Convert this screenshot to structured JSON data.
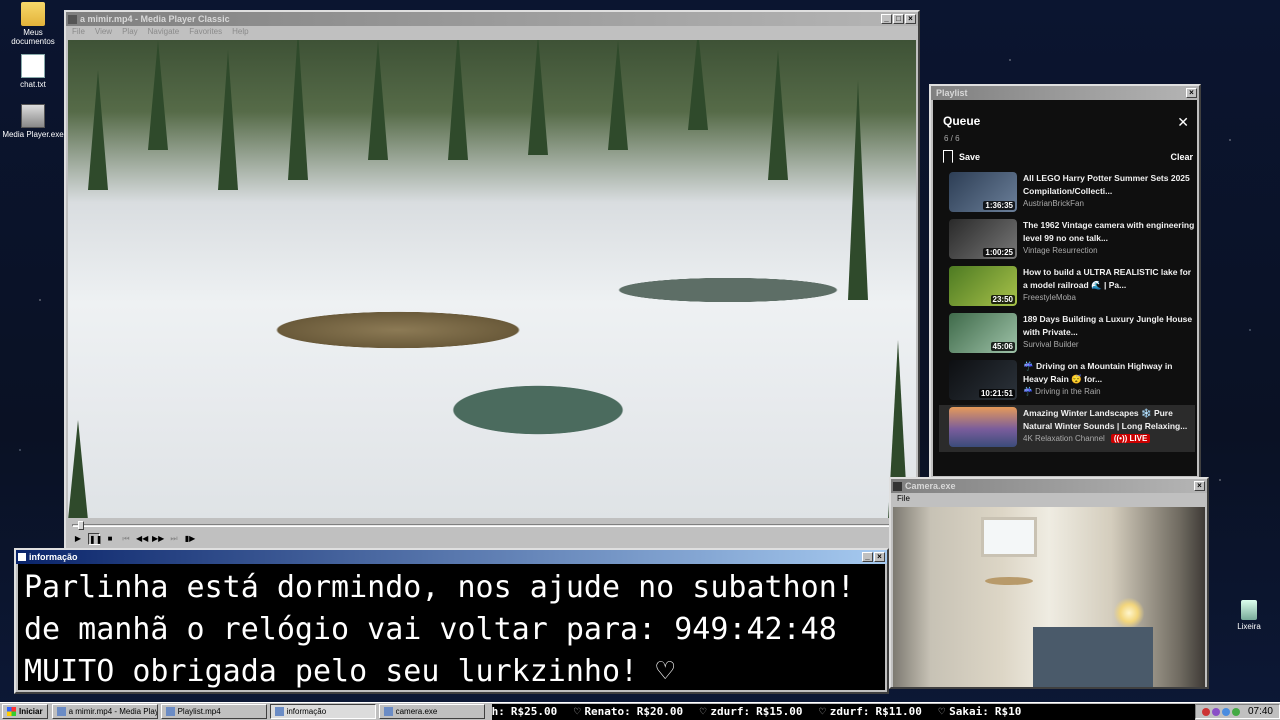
{
  "desktop": {
    "icons": [
      {
        "label": "Meus documentos"
      },
      {
        "label": "chat.txt"
      },
      {
        "label": "Media Player.exe"
      }
    ],
    "recycle_bin": "Lixeira"
  },
  "media_player": {
    "title": "a mimir.mp4 - Media Player Classic",
    "menu": [
      "File",
      "View",
      "Play",
      "Navigate",
      "Favorites",
      "Help"
    ],
    "progress": 0.005
  },
  "playlist_window": {
    "title": "Playlist",
    "queue_title": "Queue",
    "count": "6 / 6",
    "save_label": "Save",
    "clear_label": "Clear",
    "items": [
      {
        "title": "All LEGO Harry Potter Summer Sets 2025 Compilation/Collecti...",
        "channel": "AustrianBrickFan",
        "duration": "1:36:35",
        "thumb": "#3a4d66"
      },
      {
        "title": "The 1962 Vintage camera with engineering level 99 no one talk...",
        "channel": "Vintage Resurrection",
        "duration": "1:00:25",
        "thumb": "#4b4b4b"
      },
      {
        "title": "How to build a ULTRA REALISTIC lake for a model railroad 🌊 | Pa...",
        "channel": "FreestyleMoba",
        "duration": "23:50",
        "thumb": "#6a8f3a"
      },
      {
        "title": "189 Days Building a Luxury Jungle House with Private...",
        "channel": "Survival Builder",
        "duration": "45:06",
        "thumb": "#5f8a6a"
      },
      {
        "title": "☔ Driving on a Mountain Highway in Heavy Rain 😴 for...",
        "channel": "☔ Driving in the Rain",
        "duration": "10:21:51",
        "thumb": "#1c1f24"
      },
      {
        "title": "Amazing Winter Landscapes ❄️ Pure Natural Winter Sounds | Long Relaxing...",
        "channel": "4K Relaxation Channel",
        "duration": "",
        "live": "LIVE",
        "thumb": "#7b5a8c",
        "current": true
      }
    ]
  },
  "camera": {
    "title": "Camera.exe",
    "menu": [
      "File"
    ]
  },
  "info": {
    "title": "informação",
    "lines": [
      "Parlinha está dormindo, nos ajude no subathon!",
      "de manhã o relógio vai voltar para:  949:42:48",
      "MUITO obrigada pelo seu lurkzinho! ♡"
    ]
  },
  "taskbar": {
    "start": "Iniciar",
    "tasks": [
      {
        "label": "a mimir.mp4 - Media Playe..."
      },
      {
        "label": "Playlist.mp4"
      },
      {
        "label": "informação",
        "active": true
      },
      {
        "label": "camera.exe"
      }
    ],
    "ticker": [
      {
        "name": "h:",
        "amount": "R$25.00"
      },
      {
        "name": "Renato:",
        "amount": "R$20.00"
      },
      {
        "name": "zdurf:",
        "amount": "R$15.00"
      },
      {
        "name": "zdurf:",
        "amount": "R$11.00"
      },
      {
        "name": "Sakai:",
        "amount": "R$10"
      }
    ],
    "clock": "07:40"
  }
}
